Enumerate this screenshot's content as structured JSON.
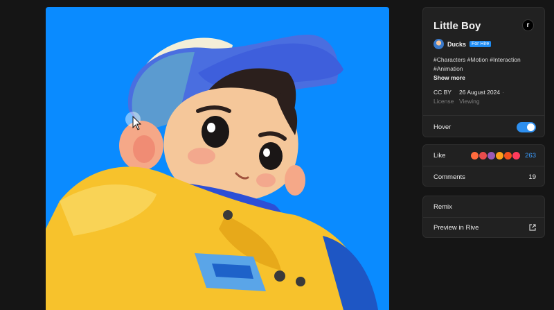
{
  "artwork": {
    "cursor": "arrow-cursor"
  },
  "details": {
    "title": "Little Boy",
    "badge": "r",
    "author": "Ducks",
    "hire_label": "For Hire",
    "tags_line1": "#Characters #Motion #Interaction",
    "tags_line2": "#Animation",
    "show_more": "Show more",
    "license_value": "CC BY",
    "license_label": "License",
    "date_value": "26 August 2024",
    "date_label": "Viewing"
  },
  "hover": {
    "label": "Hover",
    "enabled": true
  },
  "social": {
    "like_label": "Like",
    "like_count": "263",
    "comments_label": "Comments",
    "comments_count": "19",
    "reaction_colors": [
      "#ff6b3d",
      "#e84c4c",
      "#9b59b6",
      "#ff9f1a",
      "#f4511e",
      "#ff3b5c"
    ]
  },
  "actions": {
    "remix_label": "Remix",
    "preview_label": "Preview in Rive"
  },
  "colors": {
    "accent": "#2d8fef",
    "canvas": "#0a8bff",
    "panel": "#212121"
  }
}
